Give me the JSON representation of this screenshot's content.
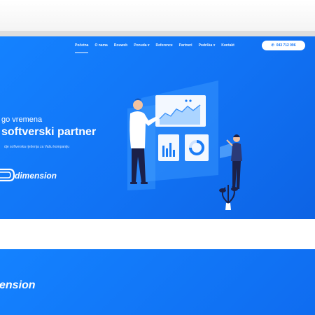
{
  "nav": {
    "items": [
      {
        "label": "Početna"
      },
      {
        "label": "O nama"
      },
      {
        "label": "Rouweb"
      },
      {
        "label": "Ponuda ▾"
      },
      {
        "label": "Reference"
      },
      {
        "label": "Partneri"
      },
      {
        "label": "Podrška ▾"
      },
      {
        "label": "Kontakt"
      }
    ]
  },
  "phone": {
    "label": "043 712 096",
    "icon": "phone-icon"
  },
  "hero": {
    "line1": "go vremena",
    "line2": "softverski partner",
    "sub": "dje softverska rješenja za Vašu kompaniju"
  },
  "logo": {
    "text": "dimension"
  },
  "section2": {
    "logo_text": "ension"
  },
  "colors": {
    "primary": "#1677f7",
    "white": "#ffffff"
  }
}
